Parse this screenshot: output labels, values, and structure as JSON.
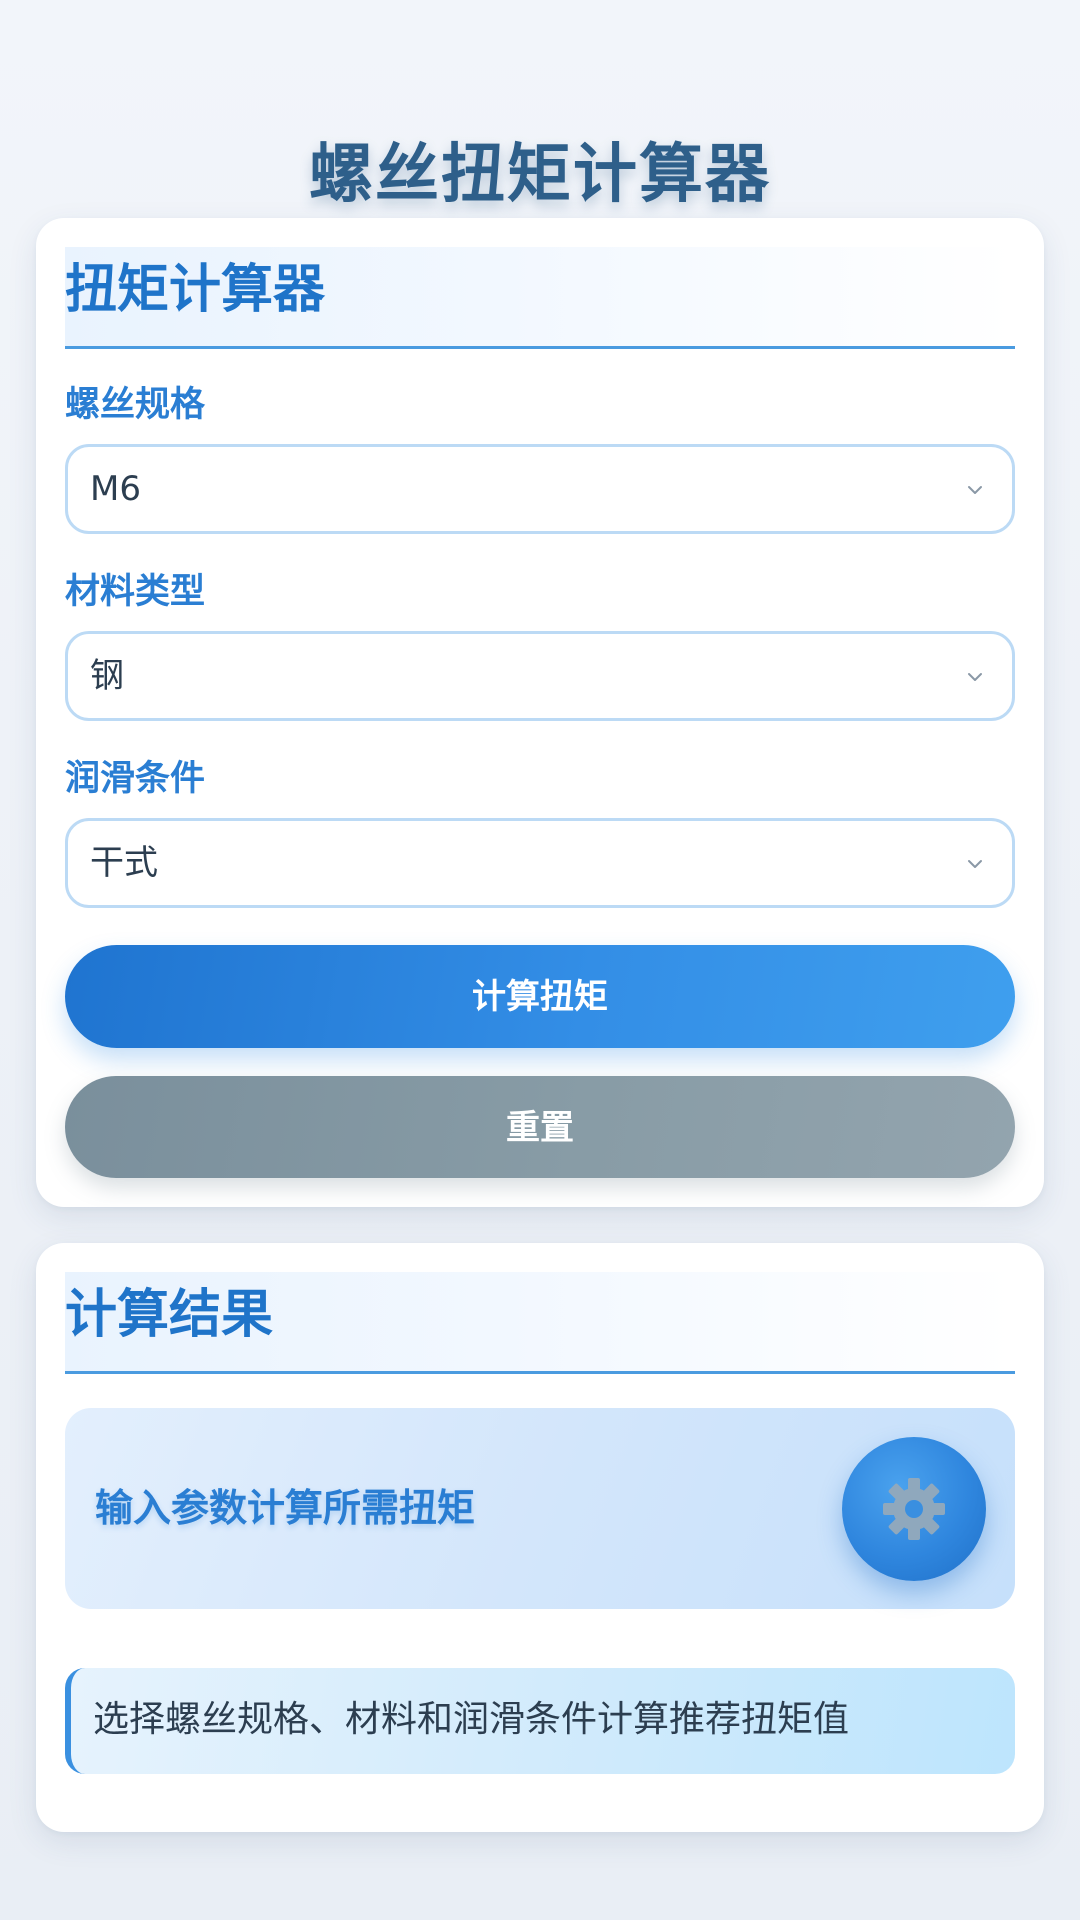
{
  "page": {
    "title": "螺丝扭矩计算器"
  },
  "calculator": {
    "header": "扭矩计算器",
    "fields": [
      {
        "label": "螺丝规格",
        "value": "M6"
      },
      {
        "label": "材料类型",
        "value": "钢"
      },
      {
        "label": "润滑条件",
        "value": "干式"
      }
    ],
    "calculate_label": "计算扭矩",
    "reset_label": "重置"
  },
  "result": {
    "header": "计算结果",
    "hint": "输入参数计算所需扭矩",
    "info": "选择螺丝规格、材料和润滑条件计算推荐扭矩值"
  },
  "icons": {
    "dropdown": "chevron-down-icon",
    "result_placeholder": "gear-icon"
  },
  "colors": {
    "accent": "#2a7ed3",
    "title": "#2e5f8a",
    "primary_button": "#338ee6",
    "secondary_button": "#889ca6"
  }
}
